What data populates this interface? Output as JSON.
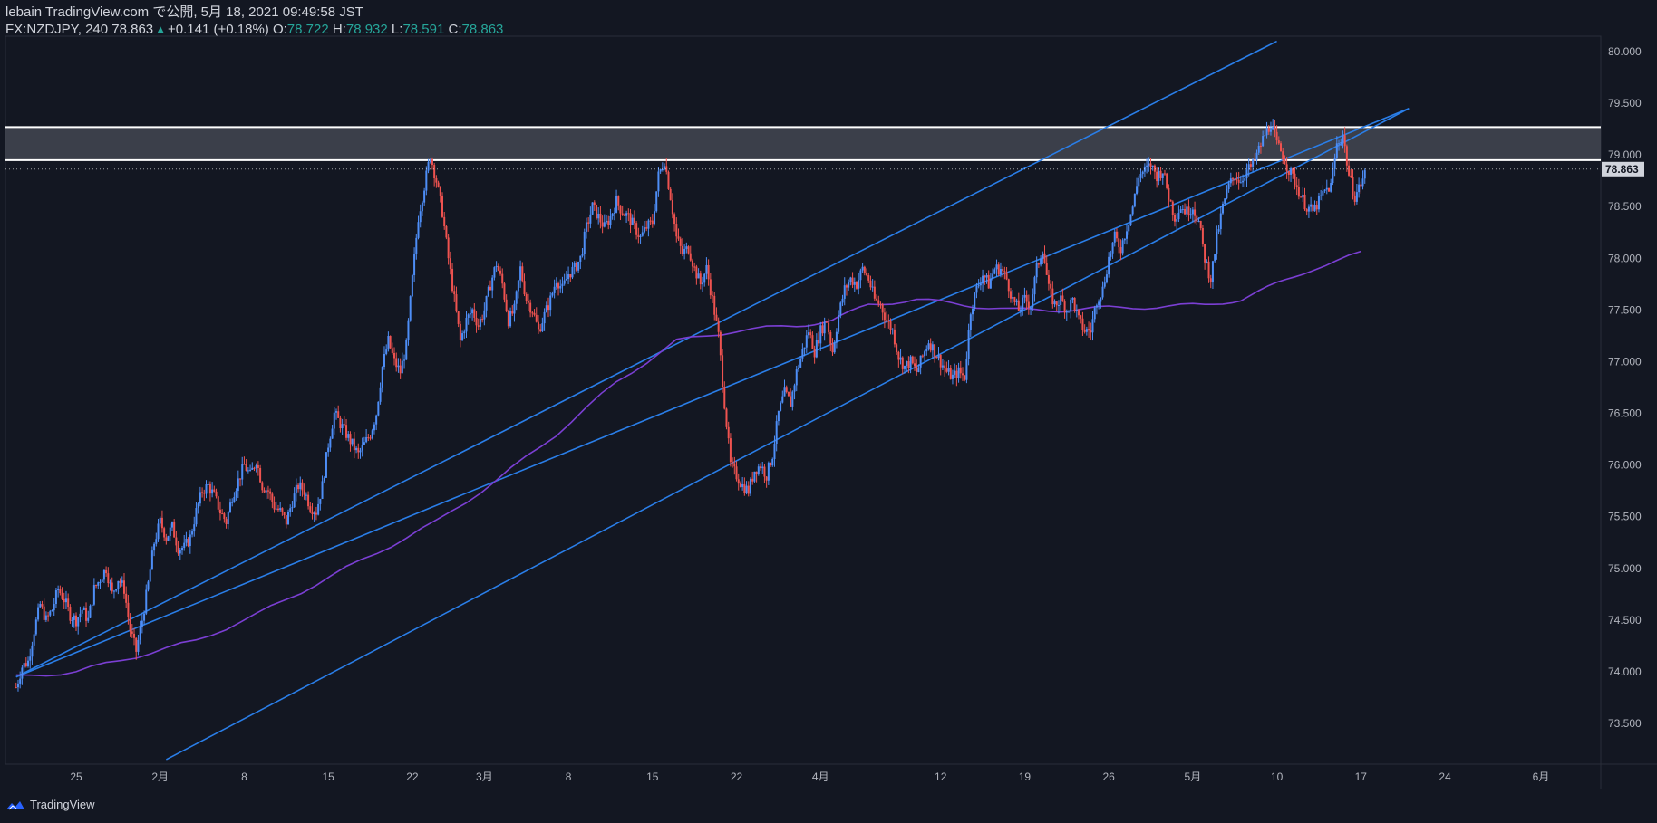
{
  "header": {
    "published": "lebain TradingView.com で公開, 5月 18, 2021 09:49:58 JST",
    "symbol": "FX:NZDJPY, 240 78.863",
    "change": "+0.141 (+0.18%)",
    "o_label": "O:",
    "o_value": "78.722",
    "h_label": "H:",
    "h_value": "78.932",
    "l_label": "L:",
    "l_value": "78.591",
    "c_label": "C:",
    "c_value": "78.863"
  },
  "footer": {
    "brand": "TradingView"
  },
  "colors": {
    "background": "#131722",
    "up": "#2962ff",
    "up_light": "#4e8ef7",
    "down": "#ef5350",
    "channel": "#2a7ee8",
    "ma": "#7b3fd3",
    "zone": "#434651",
    "zone_border": "#ffffff"
  },
  "chart_data": {
    "type": "candlestick",
    "symbol": "FX:NZDJPY",
    "timeframe": "240",
    "last_price": 78.863,
    "price_label": "78.863",
    "ylim": [
      73.1,
      80.1
    ],
    "y_ticks": [
      "80.000",
      "79.500",
      "79.000",
      "78.500",
      "78.000",
      "77.500",
      "77.000",
      "76.500",
      "76.000",
      "75.500",
      "75.000",
      "74.500",
      "74.000",
      "73.500"
    ],
    "x_ticks": [
      "25",
      "2月",
      "8",
      "15",
      "22",
      "3月",
      "8",
      "15",
      "22",
      "4月",
      "12",
      "19",
      "26",
      "5月",
      "10",
      "17",
      "24",
      "6月"
    ],
    "x_tick_days": [
      0,
      7,
      14,
      21,
      28,
      34,
      41,
      48,
      55,
      62,
      72,
      79,
      86,
      93,
      100,
      107,
      114,
      122
    ],
    "close_path": [
      [
        -5,
        73.85
      ],
      [
        -4.5,
        74.05
      ],
      [
        -4,
        74.1
      ],
      [
        -3.5,
        74.4
      ],
      [
        -3,
        74.65
      ],
      [
        -2.5,
        74.5
      ],
      [
        -2,
        74.6
      ],
      [
        -1.5,
        74.8
      ],
      [
        -1,
        74.7
      ],
      [
        -0.5,
        74.55
      ],
      [
        0,
        74.5
      ],
      [
        0.5,
        74.6
      ],
      [
        1,
        74.5
      ],
      [
        1.5,
        74.8
      ],
      [
        2,
        74.9
      ],
      [
        2.5,
        75.0
      ],
      [
        3,
        74.75
      ],
      [
        3.5,
        74.9
      ],
      [
        4,
        74.8
      ],
      [
        4.5,
        74.4
      ],
      [
        5,
        74.2
      ],
      [
        5.5,
        74.5
      ],
      [
        6,
        74.85
      ],
      [
        6.5,
        75.25
      ],
      [
        7,
        75.45
      ],
      [
        7.5,
        75.3
      ],
      [
        8,
        75.4
      ],
      [
        8.5,
        75.2
      ],
      [
        9,
        75.2
      ],
      [
        9.5,
        75.3
      ],
      [
        10,
        75.55
      ],
      [
        10.5,
        75.75
      ],
      [
        11,
        75.8
      ],
      [
        11.5,
        75.7
      ],
      [
        12,
        75.55
      ],
      [
        12.5,
        75.45
      ],
      [
        13,
        75.7
      ],
      [
        13.5,
        75.85
      ],
      [
        14,
        76.0
      ],
      [
        14.5,
        75.9
      ],
      [
        15,
        76.05
      ],
      [
        15.5,
        75.8
      ],
      [
        16,
        75.75
      ],
      [
        16.5,
        75.6
      ],
      [
        17,
        75.55
      ],
      [
        17.5,
        75.45
      ],
      [
        18,
        75.65
      ],
      [
        18.5,
        75.8
      ],
      [
        19,
        75.75
      ],
      [
        19.5,
        75.6
      ],
      [
        20,
        75.55
      ],
      [
        20.5,
        75.8
      ],
      [
        21,
        76.2
      ],
      [
        21.5,
        76.5
      ],
      [
        22,
        76.4
      ],
      [
        22.5,
        76.3
      ],
      [
        23,
        76.2
      ],
      [
        23.5,
        76.1
      ],
      [
        24,
        76.2
      ],
      [
        24.5,
        76.3
      ],
      [
        25,
        76.5
      ],
      [
        25.5,
        76.95
      ],
      [
        26,
        77.2
      ],
      [
        26.5,
        77.0
      ],
      [
        27,
        76.9
      ],
      [
        27.5,
        77.15
      ],
      [
        28,
        77.8
      ],
      [
        28.5,
        78.4
      ],
      [
        29,
        78.7
      ],
      [
        29.5,
        79.0
      ],
      [
        30,
        78.75
      ],
      [
        30.5,
        78.45
      ],
      [
        31,
        78.0
      ],
      [
        31.5,
        77.6
      ],
      [
        32,
        77.2
      ],
      [
        32.5,
        77.4
      ],
      [
        33,
        77.5
      ],
      [
        33.5,
        77.35
      ],
      [
        34,
        77.5
      ],
      [
        34.5,
        77.75
      ],
      [
        35,
        77.95
      ],
      [
        35.5,
        77.75
      ],
      [
        36,
        77.4
      ],
      [
        36.5,
        77.5
      ],
      [
        37,
        77.9
      ],
      [
        37.5,
        77.6
      ],
      [
        38,
        77.5
      ],
      [
        38.5,
        77.3
      ],
      [
        39,
        77.45
      ],
      [
        39.5,
        77.6
      ],
      [
        40,
        77.8
      ],
      [
        40.5,
        77.7
      ],
      [
        41,
        77.85
      ],
      [
        41.5,
        77.9
      ],
      [
        42,
        78.0
      ],
      [
        42.5,
        78.3
      ],
      [
        43,
        78.5
      ],
      [
        43.5,
        78.4
      ],
      [
        44,
        78.3
      ],
      [
        44.5,
        78.4
      ],
      [
        45,
        78.55
      ],
      [
        45.5,
        78.45
      ],
      [
        46,
        78.4
      ],
      [
        46.5,
        78.3
      ],
      [
        47,
        78.2
      ],
      [
        47.5,
        78.3
      ],
      [
        48,
        78.35
      ],
      [
        48.5,
        78.8
      ],
      [
        49,
        78.95
      ],
      [
        49.5,
        78.6
      ],
      [
        50,
        78.2
      ],
      [
        50.5,
        78.05
      ],
      [
        51,
        78.1
      ],
      [
        51.5,
        77.9
      ],
      [
        52,
        77.75
      ],
      [
        52.5,
        77.9
      ],
      [
        53,
        77.6
      ],
      [
        53.5,
        77.25
      ],
      [
        54,
        76.6
      ],
      [
        54.5,
        76.0
      ],
      [
        55,
        75.9
      ],
      [
        55.5,
        75.8
      ],
      [
        56,
        75.75
      ],
      [
        56.5,
        75.95
      ],
      [
        57,
        76.0
      ],
      [
        57.5,
        75.9
      ],
      [
        58,
        76.1
      ],
      [
        58.5,
        76.5
      ],
      [
        59,
        76.7
      ],
      [
        59.5,
        76.6
      ],
      [
        60,
        76.9
      ],
      [
        60.5,
        77.1
      ],
      [
        61,
        77.3
      ],
      [
        61.5,
        77.1
      ],
      [
        62,
        77.3
      ],
      [
        62.5,
        77.4
      ],
      [
        63,
        77.1
      ],
      [
        63.5,
        77.45
      ],
      [
        64,
        77.7
      ],
      [
        64.5,
        77.8
      ],
      [
        65,
        77.75
      ],
      [
        65.5,
        77.9
      ],
      [
        66,
        77.8
      ],
      [
        66.5,
        77.6
      ],
      [
        67,
        77.55
      ],
      [
        67.5,
        77.4
      ],
      [
        68,
        77.3
      ],
      [
        68.5,
        77.05
      ],
      [
        69,
        76.95
      ],
      [
        69.5,
        77.0
      ],
      [
        70,
        76.9
      ],
      [
        70.5,
        77.05
      ],
      [
        71,
        77.2
      ],
      [
        71.5,
        77.1
      ],
      [
        72,
        77.0
      ],
      [
        72.5,
        76.9
      ],
      [
        73,
        76.85
      ],
      [
        73.5,
        76.9
      ],
      [
        74,
        76.85
      ],
      [
        74.5,
        77.5
      ],
      [
        75,
        77.7
      ],
      [
        75.5,
        77.85
      ],
      [
        76,
        77.75
      ],
      [
        76.5,
        77.9
      ],
      [
        77,
        77.9
      ],
      [
        77.5,
        77.8
      ],
      [
        78,
        77.6
      ],
      [
        78.5,
        77.5
      ],
      [
        79,
        77.6
      ],
      [
        79.5,
        77.55
      ],
      [
        80,
        77.9
      ],
      [
        80.5,
        78.1
      ],
      [
        81,
        77.7
      ],
      [
        81.5,
        77.55
      ],
      [
        82,
        77.6
      ],
      [
        82.5,
        77.5
      ],
      [
        83,
        77.6
      ],
      [
        83.5,
        77.4
      ],
      [
        84,
        77.3
      ],
      [
        84.5,
        77.3
      ],
      [
        85,
        77.6
      ],
      [
        85.5,
        77.7
      ],
      [
        86,
        78.0
      ],
      [
        86.5,
        78.2
      ],
      [
        87,
        78.1
      ],
      [
        87.5,
        78.3
      ],
      [
        88,
        78.5
      ],
      [
        88.5,
        78.8
      ],
      [
        89,
        78.85
      ],
      [
        89.5,
        78.9
      ],
      [
        90,
        78.8
      ],
      [
        90.5,
        78.85
      ],
      [
        91,
        78.6
      ],
      [
        91.5,
        78.4
      ],
      [
        92,
        78.5
      ],
      [
        92.5,
        78.45
      ],
      [
        93,
        78.5
      ],
      [
        93.5,
        78.35
      ],
      [
        94,
        78.0
      ],
      [
        94.5,
        77.8
      ],
      [
        95,
        78.2
      ],
      [
        95.5,
        78.5
      ],
      [
        96,
        78.7
      ],
      [
        96.5,
        78.8
      ],
      [
        97,
        78.75
      ],
      [
        97.5,
        78.85
      ],
      [
        98,
        78.9
      ],
      [
        98.5,
        79.05
      ],
      [
        99,
        79.2
      ],
      [
        99.5,
        79.3
      ],
      [
        100,
        79.1
      ],
      [
        100.5,
        79.0
      ],
      [
        101,
        78.85
      ],
      [
        101.5,
        78.75
      ],
      [
        102,
        78.6
      ],
      [
        102.5,
        78.5
      ],
      [
        103,
        78.45
      ],
      [
        103.5,
        78.55
      ],
      [
        104,
        78.65
      ],
      [
        104.5,
        78.7
      ],
      [
        105,
        79.1
      ],
      [
        105.5,
        79.2
      ],
      [
        106,
        78.8
      ],
      [
        106.5,
        78.6
      ],
      [
        107,
        78.72
      ],
      [
        107.5,
        78.863
      ]
    ],
    "ma_path": [
      [
        -5,
        73.95
      ],
      [
        0,
        74.0
      ],
      [
        5,
        74.15
      ],
      [
        10,
        74.3
      ],
      [
        15,
        74.55
      ],
      [
        20,
        74.85
      ],
      [
        25,
        75.15
      ],
      [
        30,
        75.45
      ],
      [
        35,
        75.85
      ],
      [
        40,
        76.3
      ],
      [
        45,
        76.8
      ],
      [
        50,
        77.2
      ],
      [
        55,
        77.3
      ],
      [
        60,
        77.35
      ],
      [
        63,
        77.4
      ],
      [
        66,
        77.55
      ],
      [
        70,
        77.6
      ],
      [
        74,
        77.55
      ],
      [
        78,
        77.5
      ],
      [
        82,
        77.5
      ],
      [
        86,
        77.52
      ],
      [
        90,
        77.53
      ],
      [
        94,
        77.55
      ],
      [
        97,
        77.6
      ],
      [
        100,
        77.75
      ],
      [
        103,
        77.9
      ],
      [
        107,
        78.05
      ]
    ],
    "resistance_zone": [
      78.95,
      79.27
    ],
    "channel_upper": [
      [
        -5,
        73.95
      ],
      [
        100,
        80.1
      ]
    ],
    "channel_middle": [
      [
        -5,
        73.95
      ],
      [
        100,
        80.1
      ]
    ],
    "channel_lines": [
      [
        [
          -5,
          73.95
        ],
        [
          100,
          80.1
        ]
      ],
      [
        [
          -5,
          73.95
        ],
        [
          111,
          79.45
        ]
      ],
      [
        [
          7.5,
          73.15
        ],
        [
          111,
          79.45
        ]
      ]
    ]
  }
}
